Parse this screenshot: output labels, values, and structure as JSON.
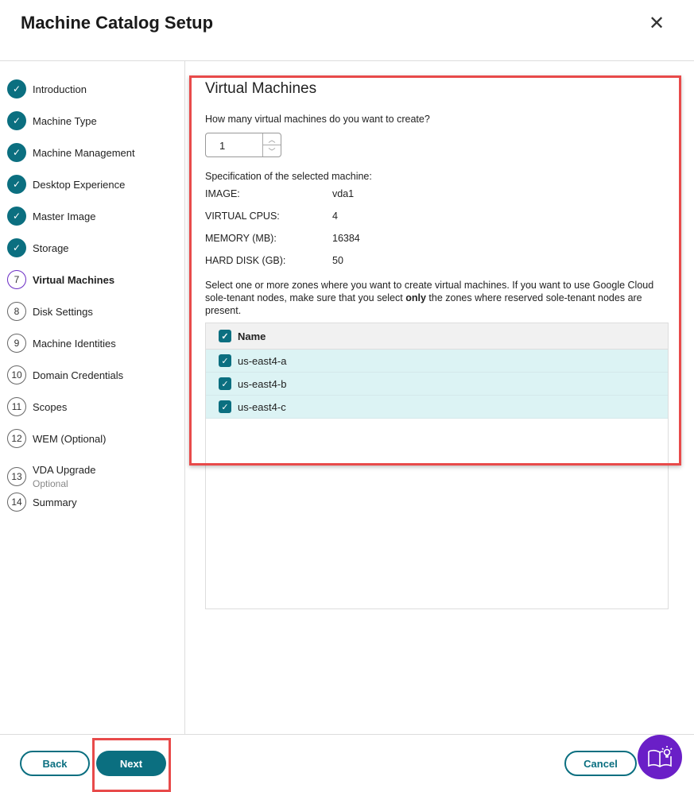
{
  "header": {
    "title": "Machine Catalog Setup",
    "close_icon": "close-icon"
  },
  "steps": [
    {
      "num": "1",
      "label": "Introduction",
      "state": "done"
    },
    {
      "num": "2",
      "label": "Machine Type",
      "state": "done"
    },
    {
      "num": "3",
      "label": "Machine Management",
      "state": "done"
    },
    {
      "num": "4",
      "label": "Desktop Experience",
      "state": "done"
    },
    {
      "num": "5",
      "label": "Master Image",
      "state": "done"
    },
    {
      "num": "6",
      "label": "Storage",
      "state": "done"
    },
    {
      "num": "7",
      "label": "Virtual Machines",
      "state": "current"
    },
    {
      "num": "8",
      "label": "Disk Settings",
      "state": "todo"
    },
    {
      "num": "9",
      "label": "Machine Identities",
      "state": "todo"
    },
    {
      "num": "10",
      "label": "Domain Credentials",
      "state": "todo"
    },
    {
      "num": "11",
      "label": "Scopes",
      "state": "todo"
    },
    {
      "num": "12",
      "label": "WEM (Optional)",
      "state": "todo"
    },
    {
      "num": "13",
      "label": "VDA Upgrade",
      "sub": "Optional",
      "state": "todo"
    },
    {
      "num": "14",
      "label": "Summary",
      "state": "todo"
    }
  ],
  "main": {
    "title": "Virtual Machines",
    "question": "How many virtual machines do you want to create?",
    "vm_count": "1",
    "spec_label": "Specification of the selected machine:",
    "specs": [
      {
        "k": "IMAGE:",
        "v": "vda1"
      },
      {
        "k": "VIRTUAL CPUS:",
        "v": "4"
      },
      {
        "k": "MEMORY (MB):",
        "v": "16384"
      },
      {
        "k": "HARD DISK (GB):",
        "v": "50"
      }
    ],
    "zones_text_1": "Select one or more zones where you want to create virtual machines. If you want to use Google Cloud sole-tenant nodes, make sure that you select ",
    "zones_text_bold": "only",
    "zones_text_2": " the zones where reserved sole-tenant nodes are present.",
    "table": {
      "header": "Name",
      "rows": [
        "us-east4-a",
        "us-east4-b",
        "us-east4-c"
      ]
    }
  },
  "footer": {
    "back": "Back",
    "next": "Next",
    "cancel": "Cancel"
  }
}
